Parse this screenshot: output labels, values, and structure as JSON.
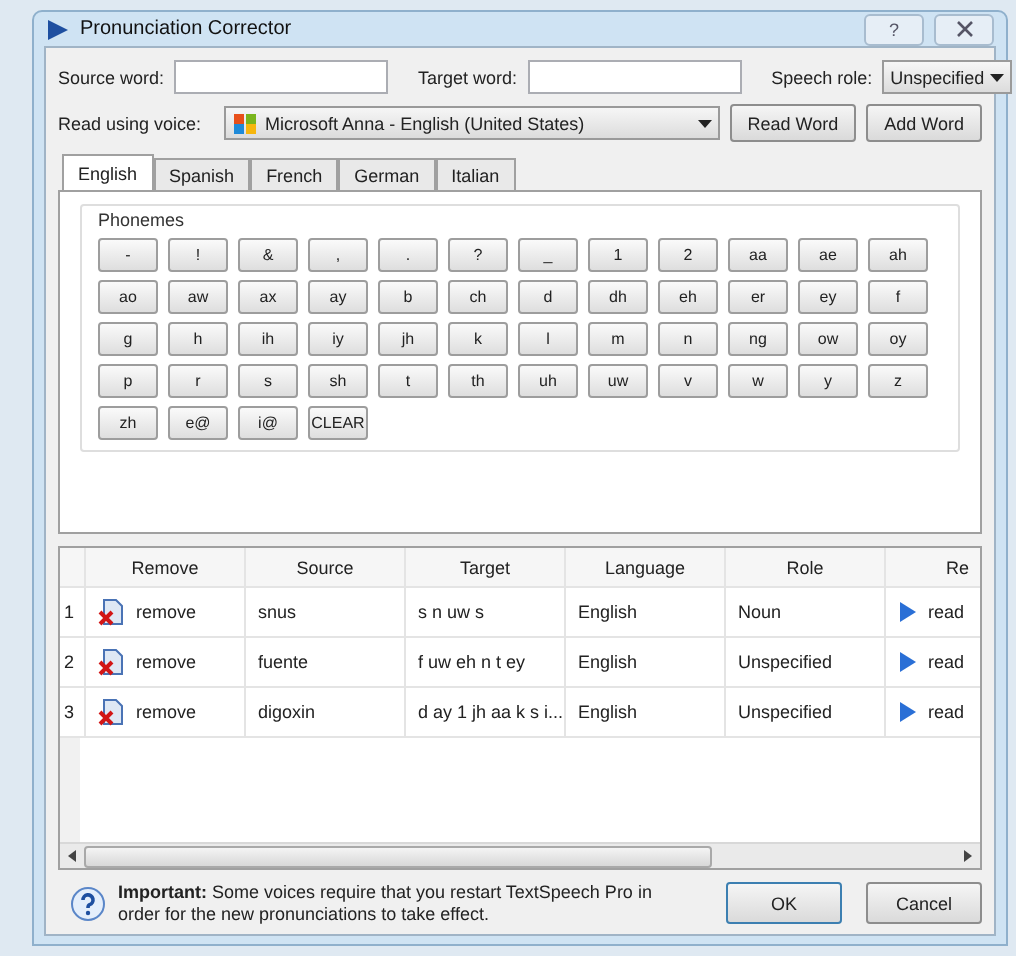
{
  "window": {
    "title": "Pronunciation Corrector",
    "help_button": "?"
  },
  "source_word": {
    "label": "Source word:"
  },
  "target_word": {
    "label": "Target word:"
  },
  "speech_role": {
    "label": "Speech role:",
    "value": "Unspecified"
  },
  "voice": {
    "label": "Read using voice:",
    "value": "Microsoft Anna - English (United States)"
  },
  "buttons": [
    "Read Word",
    "Add Word"
  ],
  "tabs": [
    {
      "label": "English",
      "selected": true
    },
    {
      "label": "Spanish",
      "selected": false
    },
    {
      "label": "French",
      "selected": false
    },
    {
      "label": "German",
      "selected": false
    },
    {
      "label": "Italian",
      "selected": false
    }
  ],
  "phonemes": {
    "title": "Phonemes",
    "keys": [
      "-",
      "!",
      "&",
      ",",
      ".",
      "?",
      "_",
      "1",
      "2",
      "aa",
      "ae",
      "ah",
      "ao",
      "aw",
      "ax",
      "ay",
      "b",
      "ch",
      "d",
      "dh",
      "eh",
      "er",
      "ey",
      "f",
      "g",
      "h",
      "ih",
      "iy",
      "jh",
      "k",
      "l",
      "m",
      "n",
      "ng",
      "ow",
      "oy",
      "p",
      "r",
      "s",
      "sh",
      "t",
      "th",
      "uh",
      "uw",
      "v",
      "w",
      "y",
      "z",
      "zh",
      "e@",
      "i@",
      "CLEAR"
    ]
  },
  "table": {
    "columns": [
      "Remove",
      "Source",
      "Target",
      "Language",
      "Role",
      "Re"
    ],
    "rows": [
      {
        "number": "1",
        "remove": "remove",
        "source": "snus",
        "target": "s n uw s",
        "language": "English",
        "role": "Noun",
        "read": "read"
      },
      {
        "number": "2",
        "remove": "remove",
        "source": "fuente",
        "target": "f uw eh n t ey",
        "language": "English",
        "role": "Unspecified",
        "read": "read"
      },
      {
        "number": "3",
        "remove": "remove",
        "source": "digoxin",
        "target": "d ay 1 jh aa k s i...",
        "language": "English",
        "role": "Unspecified",
        "read": "read"
      }
    ]
  },
  "note": "**Important:** Some voices require that you restart TextSpeech Pro in order for the new pronunciations to take effect.",
  "dialog_buttons": [
    "OK",
    "Cancel"
  ]
}
